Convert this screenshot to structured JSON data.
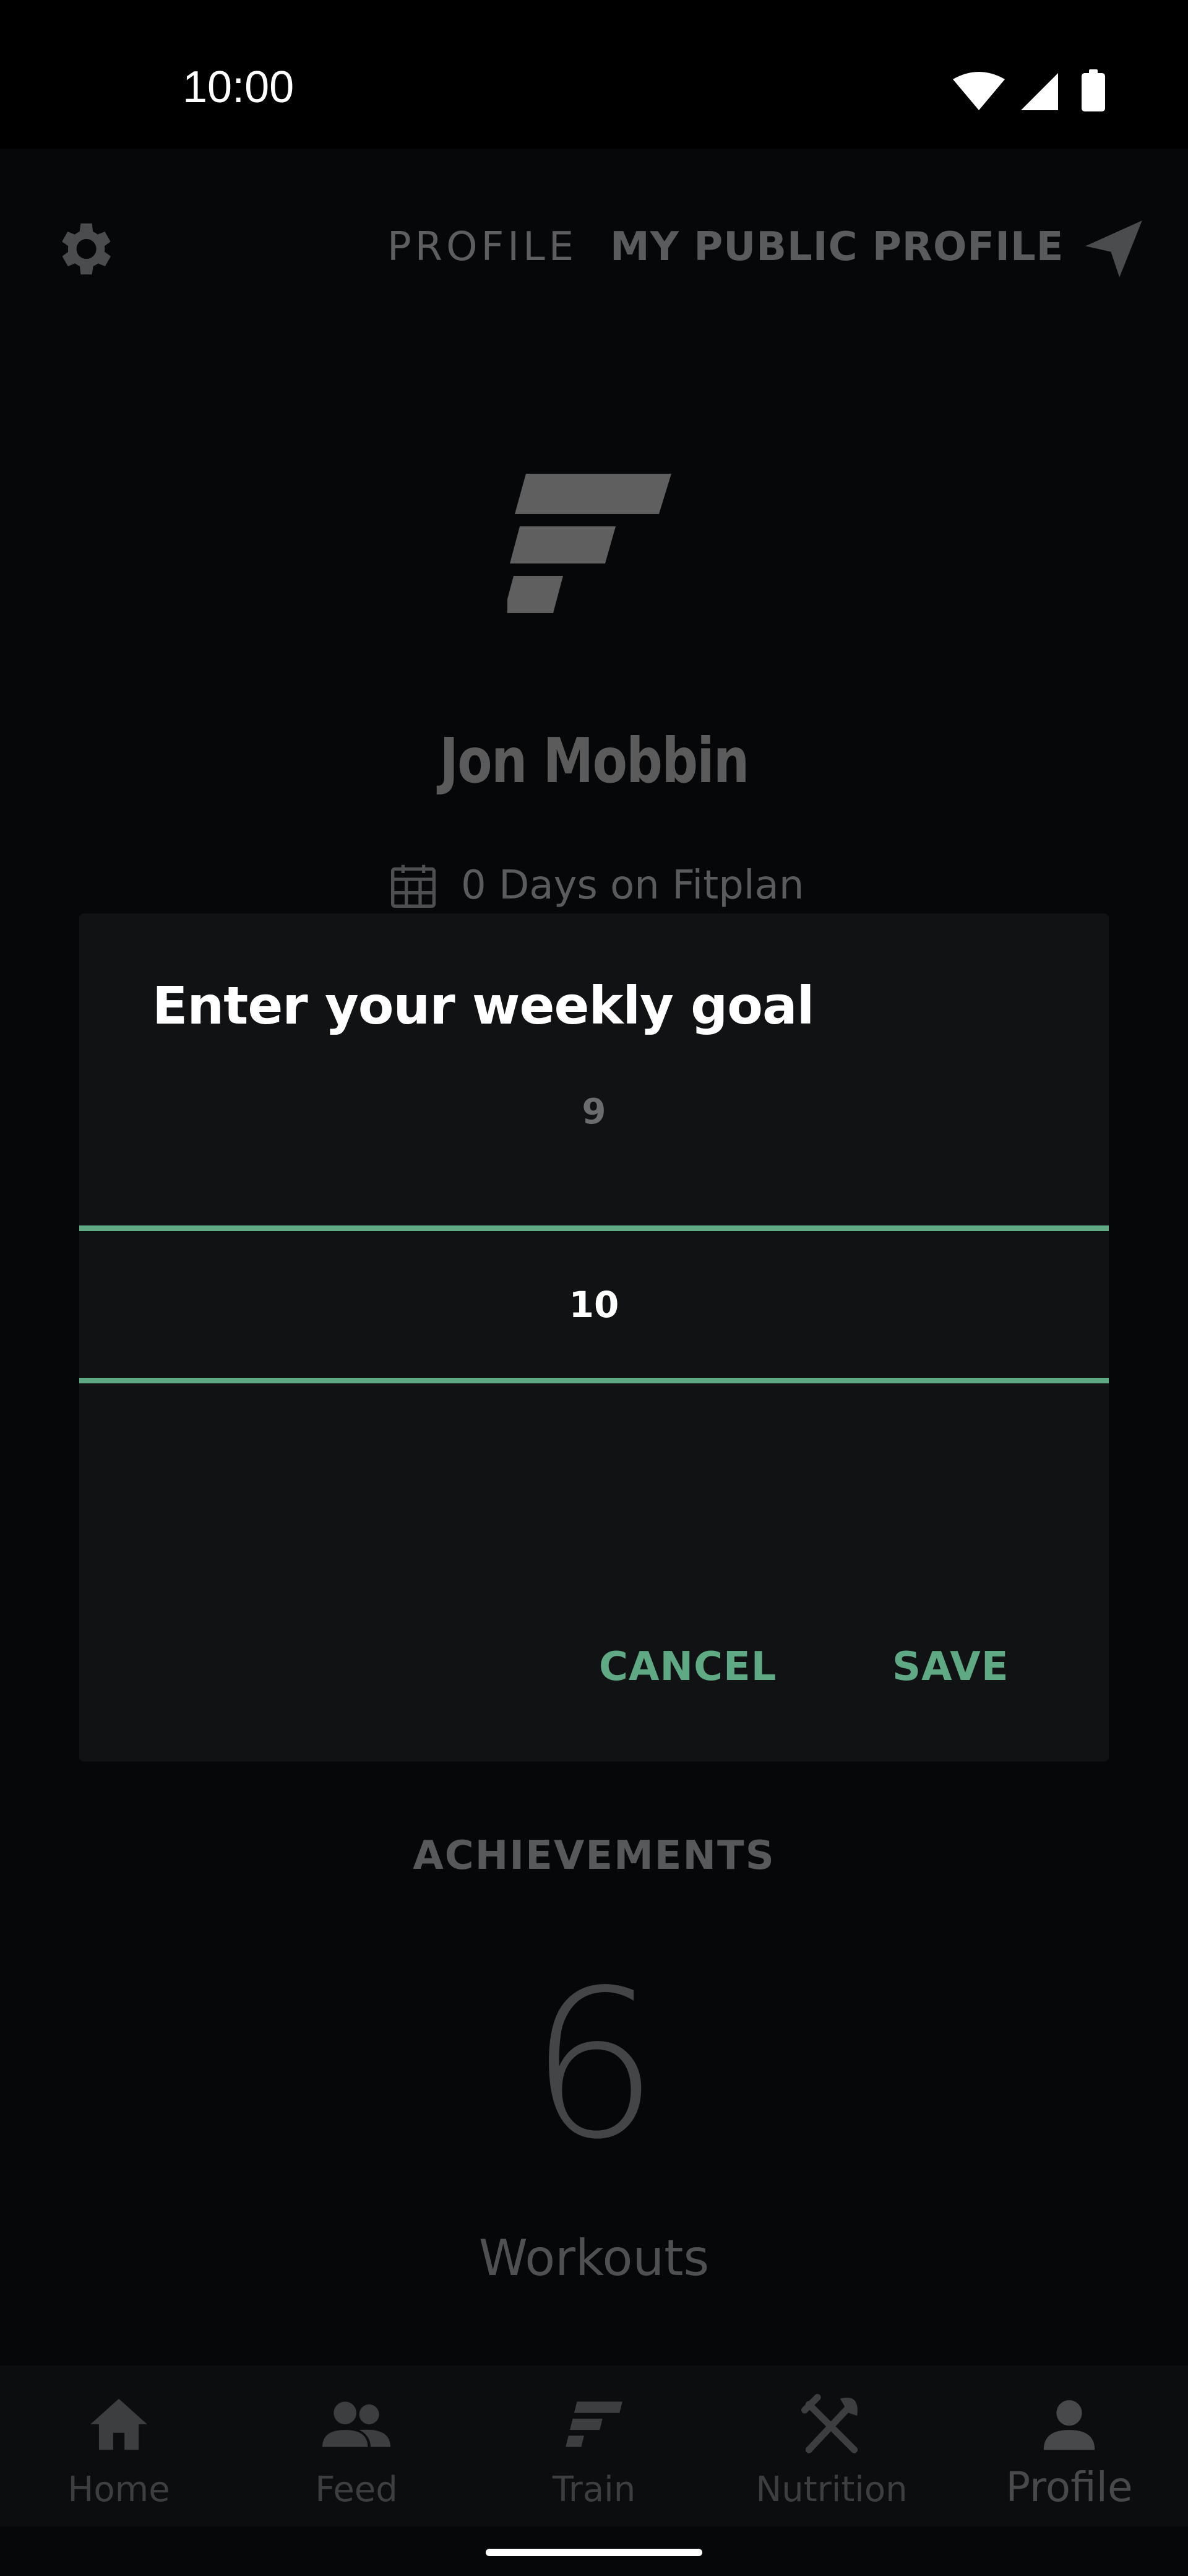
{
  "status_bar": {
    "time": "10:00",
    "icons": [
      "wifi-icon",
      "cell-signal-icon",
      "battery-icon"
    ]
  },
  "top_nav": {
    "settings_icon": "gear-icon",
    "tabs": [
      {
        "label": "PROFILE"
      },
      {
        "label": "MY PUBLIC PROFILE"
      }
    ],
    "send_icon": "paper-plane-icon"
  },
  "profile": {
    "name": "Jon Mobbin",
    "days_text": "0 Days on Fitplan",
    "achievements_label": "ACHIEVEMENTS",
    "workouts_count": "6",
    "workouts_label": "Workouts"
  },
  "dialog": {
    "title": "Enter your weekly goal",
    "picker_above": "9",
    "picker_selected": "10",
    "cancel_label": "CANCEL",
    "save_label": "SAVE"
  },
  "bottom_nav": {
    "items": [
      {
        "label": "Home",
        "icon": "home-icon"
      },
      {
        "label": "Feed",
        "icon": "people-icon"
      },
      {
        "label": "Train",
        "icon": "fitplan-logo-icon"
      },
      {
        "label": "Nutrition",
        "icon": "fork-knife-icon"
      },
      {
        "label": "Profile",
        "icon": "person-icon"
      }
    ],
    "active": "Profile"
  },
  "colors": {
    "accent": "#5fa985",
    "dialog_bg": "#111213",
    "app_bg": "#060709"
  }
}
